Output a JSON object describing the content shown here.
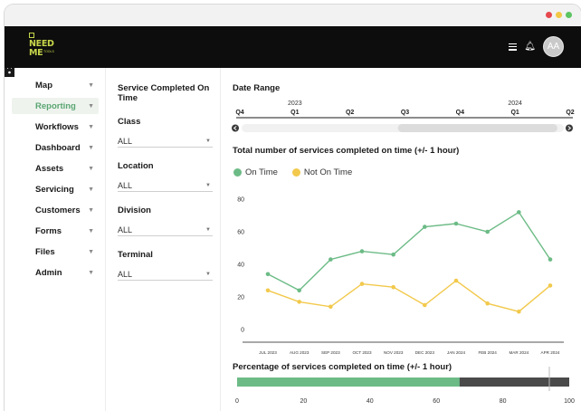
{
  "window_controls": {
    "colors": [
      "#e5484d",
      "#f2c744",
      "#5cc461"
    ]
  },
  "brand": {
    "line1": "NEED",
    "line2": "ME",
    "tag": "TOOLS",
    "color": "#c7d64a"
  },
  "user": {
    "initials": "AA"
  },
  "sidebar": {
    "items": [
      {
        "label": "Map",
        "icon": "map-icon",
        "active": false
      },
      {
        "label": "Reporting",
        "icon": "bar-chart-icon",
        "active": true
      },
      {
        "label": "Workflows",
        "icon": "workflow-icon",
        "active": false
      },
      {
        "label": "Dashboard",
        "icon": "dashboard-icon",
        "active": false
      },
      {
        "label": "Assets",
        "icon": "car-icon",
        "active": false
      },
      {
        "label": "Servicing",
        "icon": "tools-icon",
        "active": false
      },
      {
        "label": "Customers",
        "icon": "users-icon",
        "active": false
      },
      {
        "label": "Forms",
        "icon": "clipboard-icon",
        "active": false
      },
      {
        "label": "Files",
        "icon": "folder-icon",
        "active": false
      },
      {
        "label": "Admin",
        "icon": "gear-icon",
        "active": false
      }
    ]
  },
  "filters": {
    "title": "Service Completed On Time",
    "class": {
      "label": "Class",
      "value": "ALL"
    },
    "location": {
      "label": "Location",
      "value": "ALL"
    },
    "division": {
      "label": "Division",
      "value": "ALL"
    },
    "terminal": {
      "label": "Terminal",
      "value": "ALL"
    }
  },
  "date_range": {
    "title": "Date Range",
    "years": [
      "2023",
      "2024"
    ],
    "quarters": [
      "Q4",
      "Q1",
      "Q2",
      "Q3",
      "Q4",
      "Q1",
      "Q2"
    ],
    "slider_from_fraction": 0.485,
    "slider_to_fraction": 0.98
  },
  "colors": {
    "on_time": "#6cbb86",
    "not_on_time": "#f2c94c",
    "bar_rest": "#4a4a4a",
    "accent": "#5aa671"
  },
  "chart_data": [
    {
      "type": "line",
      "title": "Total number of services completed on time (+/- 1 hour)",
      "categories": [
        "JUL 2023",
        "AUG 2023",
        "SEP 2023",
        "OCT 2023",
        "NOV 2023",
        "DEC 2023",
        "JAN 2024",
        "FEB 2024",
        "MAR 2024",
        "APR 2024"
      ],
      "series": [
        {
          "name": "On Time",
          "values": [
            34,
            24,
            43,
            48,
            46,
            63,
            65,
            60,
            72,
            43
          ]
        },
        {
          "name": "Not On Time",
          "values": [
            24,
            17,
            14,
            28,
            26,
            15,
            30,
            16,
            11,
            27
          ]
        }
      ],
      "yticks": [
        0,
        20,
        40,
        60,
        80
      ],
      "ylim": [
        0,
        80
      ],
      "legend": "top-left",
      "grid": false
    },
    {
      "type": "bar",
      "orientation": "horizontal",
      "title": "Percentage of services completed on time (+/- 1 hour)",
      "value": 67,
      "xticks": [
        0,
        20,
        40,
        60,
        80,
        100
      ],
      "xlim": [
        0,
        100
      ]
    }
  ]
}
